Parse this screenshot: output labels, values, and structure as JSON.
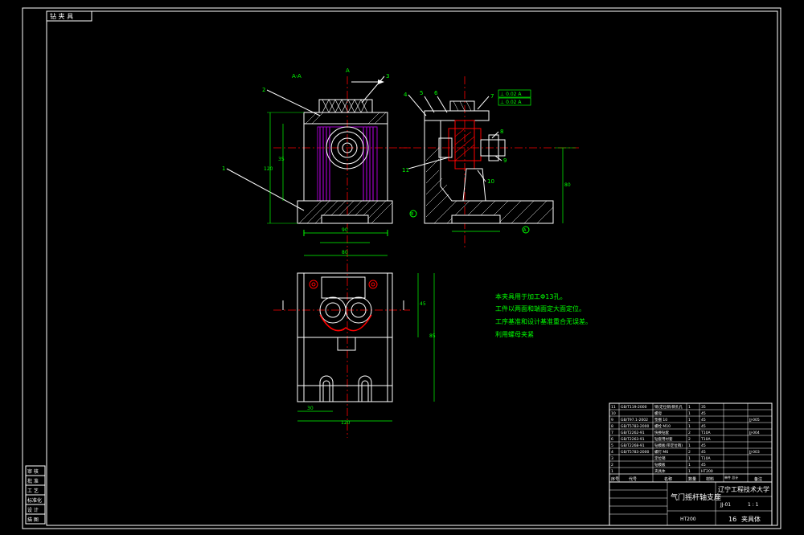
{
  "stamp": "钻 夹 具",
  "labels": {
    "section_aa": "A-A",
    "arrow_top": "A",
    "part_1": "1",
    "part_2": "2",
    "part_3": "3",
    "part_4": "4",
    "part_5": "5",
    "part_6": "6",
    "part_7": "7",
    "part_8": "8",
    "part_9": "9",
    "part_10": "10",
    "part_11": "11",
    "datum_b": "B",
    "datum_a": "A",
    "dim_height_left": "120",
    "dim_height_left2": "35",
    "dim_width_top": "90",
    "dim_width_bottom": "120",
    "dim_side_height": "80",
    "dim_plan_top": "80",
    "dim_plan_right": "85",
    "dim_plan_right2": "45",
    "dim_plan_bottom_left": "30",
    "dim_plan_bottom": "120",
    "tolerance_box": "⊥ 0.02 A"
  },
  "notes": [
    "本夹具用于加工Φ13孔。",
    "工件以两面和端面定大面定位。",
    "工序基准和设计基准重合无误差。",
    "利用螺母夹紧"
  ],
  "left_block": [
    "审 核",
    "批 准",
    "工 艺",
    "标准化",
    "设 计",
    "描 图"
  ],
  "title_block": {
    "drawing_name": "气门摇杆轴支座",
    "school": "辽宁工程技术大学",
    "scale": "1 : 1",
    "sheet": "共 张",
    "sheet_no": "第 张",
    "material": "HT200",
    "drawing_code": "JJ-01",
    "count_label": "16",
    "footer": "夹具体",
    "headers": [
      "序号",
      "代号",
      "名称",
      "数量",
      "材料",
      "单件 总计",
      "备注"
    ]
  },
  "bom": [
    [
      "11",
      "GB/T119-2000",
      "销(定位销)销孔孔",
      "1",
      "35",
      ""
    ],
    [
      "10",
      "",
      "螺母",
      "1",
      "45",
      ""
    ],
    [
      "9",
      "GB/T97.1-2002",
      "垫圈 10",
      "1",
      "45",
      "JJ-005"
    ],
    [
      "8",
      "GB/T5783-2000",
      "螺栓 M10",
      "1",
      "45",
      ""
    ],
    [
      "7",
      "GB/T2262-91",
      "快换钻套",
      "2",
      "T10A",
      "JJ-004"
    ],
    [
      "6",
      "GB/T2263-91",
      "钻套用衬套",
      "2",
      "T10A",
      ""
    ],
    [
      "5",
      "GB/T2268-91",
      "钻模板(带定位销)",
      "1",
      "45",
      ""
    ],
    [
      "4",
      "GB/T5783-2000",
      "螺钉 M6",
      "2",
      "45",
      "JJ-003"
    ],
    [
      "3",
      "",
      "定位销",
      "1",
      "T10A",
      ""
    ],
    [
      "2",
      "",
      "钻模板",
      "1",
      "45",
      ""
    ],
    [
      "1",
      "",
      "夹具体",
      "1",
      "HT200",
      ""
    ]
  ]
}
